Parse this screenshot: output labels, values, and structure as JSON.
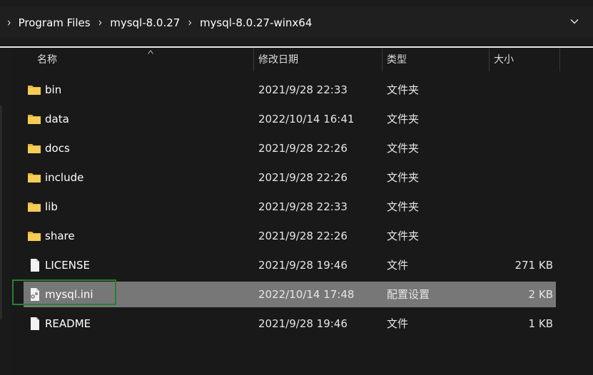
{
  "breadcrumb": {
    "items": [
      "Program Files",
      "mysql-8.0.27",
      "mysql-8.0.27-winx64"
    ]
  },
  "columns": {
    "name": "名称",
    "modified": "修改日期",
    "type": "类型",
    "size": "大小"
  },
  "files": [
    {
      "name": "bin",
      "modified": "2021/9/28 22:33",
      "type": "文件夹",
      "size": "",
      "icon": "folder-icon"
    },
    {
      "name": "data",
      "modified": "2022/10/14 16:41",
      "type": "文件夹",
      "size": "",
      "icon": "folder-icon"
    },
    {
      "name": "docs",
      "modified": "2021/9/28 22:26",
      "type": "文件夹",
      "size": "",
      "icon": "folder-icon"
    },
    {
      "name": "include",
      "modified": "2021/9/28 22:26",
      "type": "文件夹",
      "size": "",
      "icon": "folder-icon"
    },
    {
      "name": "lib",
      "modified": "2021/9/28 22:33",
      "type": "文件夹",
      "size": "",
      "icon": "folder-icon"
    },
    {
      "name": "share",
      "modified": "2021/9/28 22:26",
      "type": "文件夹",
      "size": "",
      "icon": "folder-icon"
    },
    {
      "name": "LICENSE",
      "modified": "2021/9/28 19:46",
      "type": "文件",
      "size": "271 KB",
      "icon": "file-icon"
    },
    {
      "name": "mysql.ini",
      "modified": "2022/10/14 17:48",
      "type": "配置设置",
      "size": "2 KB",
      "icon": "config-file-icon",
      "selected": true
    },
    {
      "name": "README",
      "modified": "2021/9/28 19:46",
      "type": "文件",
      "size": "1 KB",
      "icon": "file-icon"
    }
  ],
  "colors": {
    "background": "#191919",
    "selected_row": "#777777",
    "highlight_border": "#2e7d32",
    "folder": "#f0c44c"
  }
}
